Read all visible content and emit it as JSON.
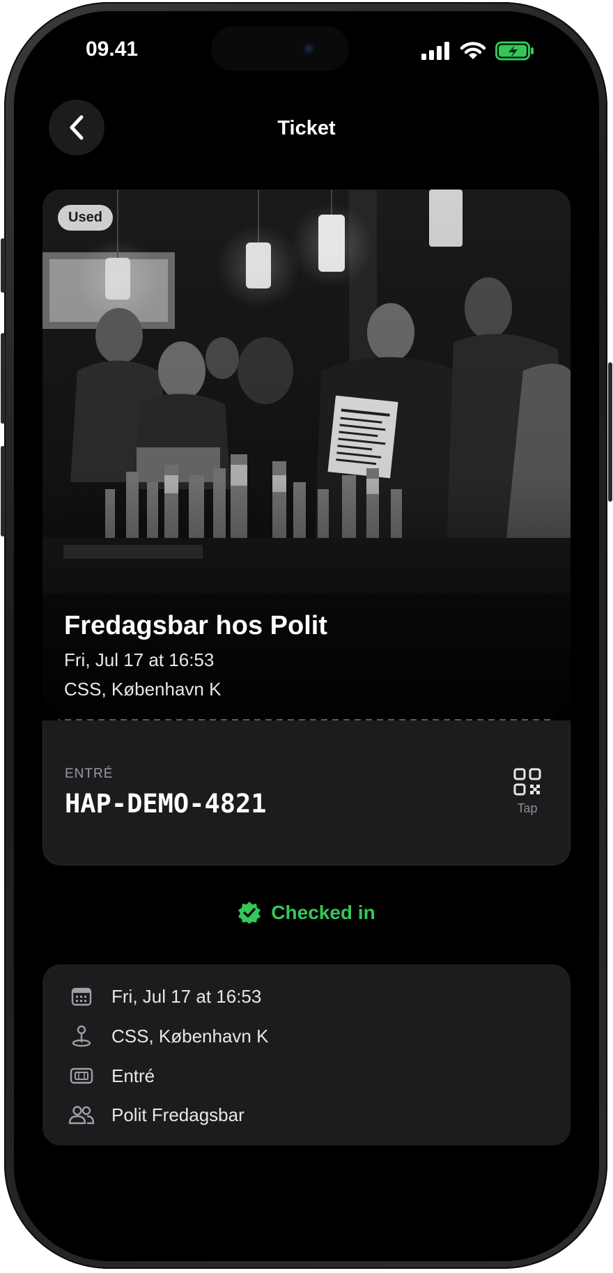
{
  "status_bar": {
    "time": "09.41"
  },
  "header": {
    "title": "Ticket"
  },
  "ticket": {
    "badge": "Used",
    "event_title": "Fredagsbar hos Polit",
    "date": "Fri, Jul 17 at 16:53",
    "venue": "CSS, København K",
    "entry_label": "ENTRÉ",
    "code": "HAP-DEMO-4821",
    "qr_label": "Tap"
  },
  "status": {
    "label": "Checked in",
    "color": "#34c759"
  },
  "details": [
    {
      "icon": "calendar-icon",
      "text": "Fri, Jul 17 at 16:53"
    },
    {
      "icon": "location-pin-icon",
      "text": "CSS, København K"
    },
    {
      "icon": "ticket-icon",
      "text": "Entré"
    },
    {
      "icon": "people-icon",
      "text": "Polit Fredagsbar"
    }
  ],
  "colors": {
    "background": "#000000",
    "card": "#1c1c1e",
    "accent": "#34c759"
  }
}
